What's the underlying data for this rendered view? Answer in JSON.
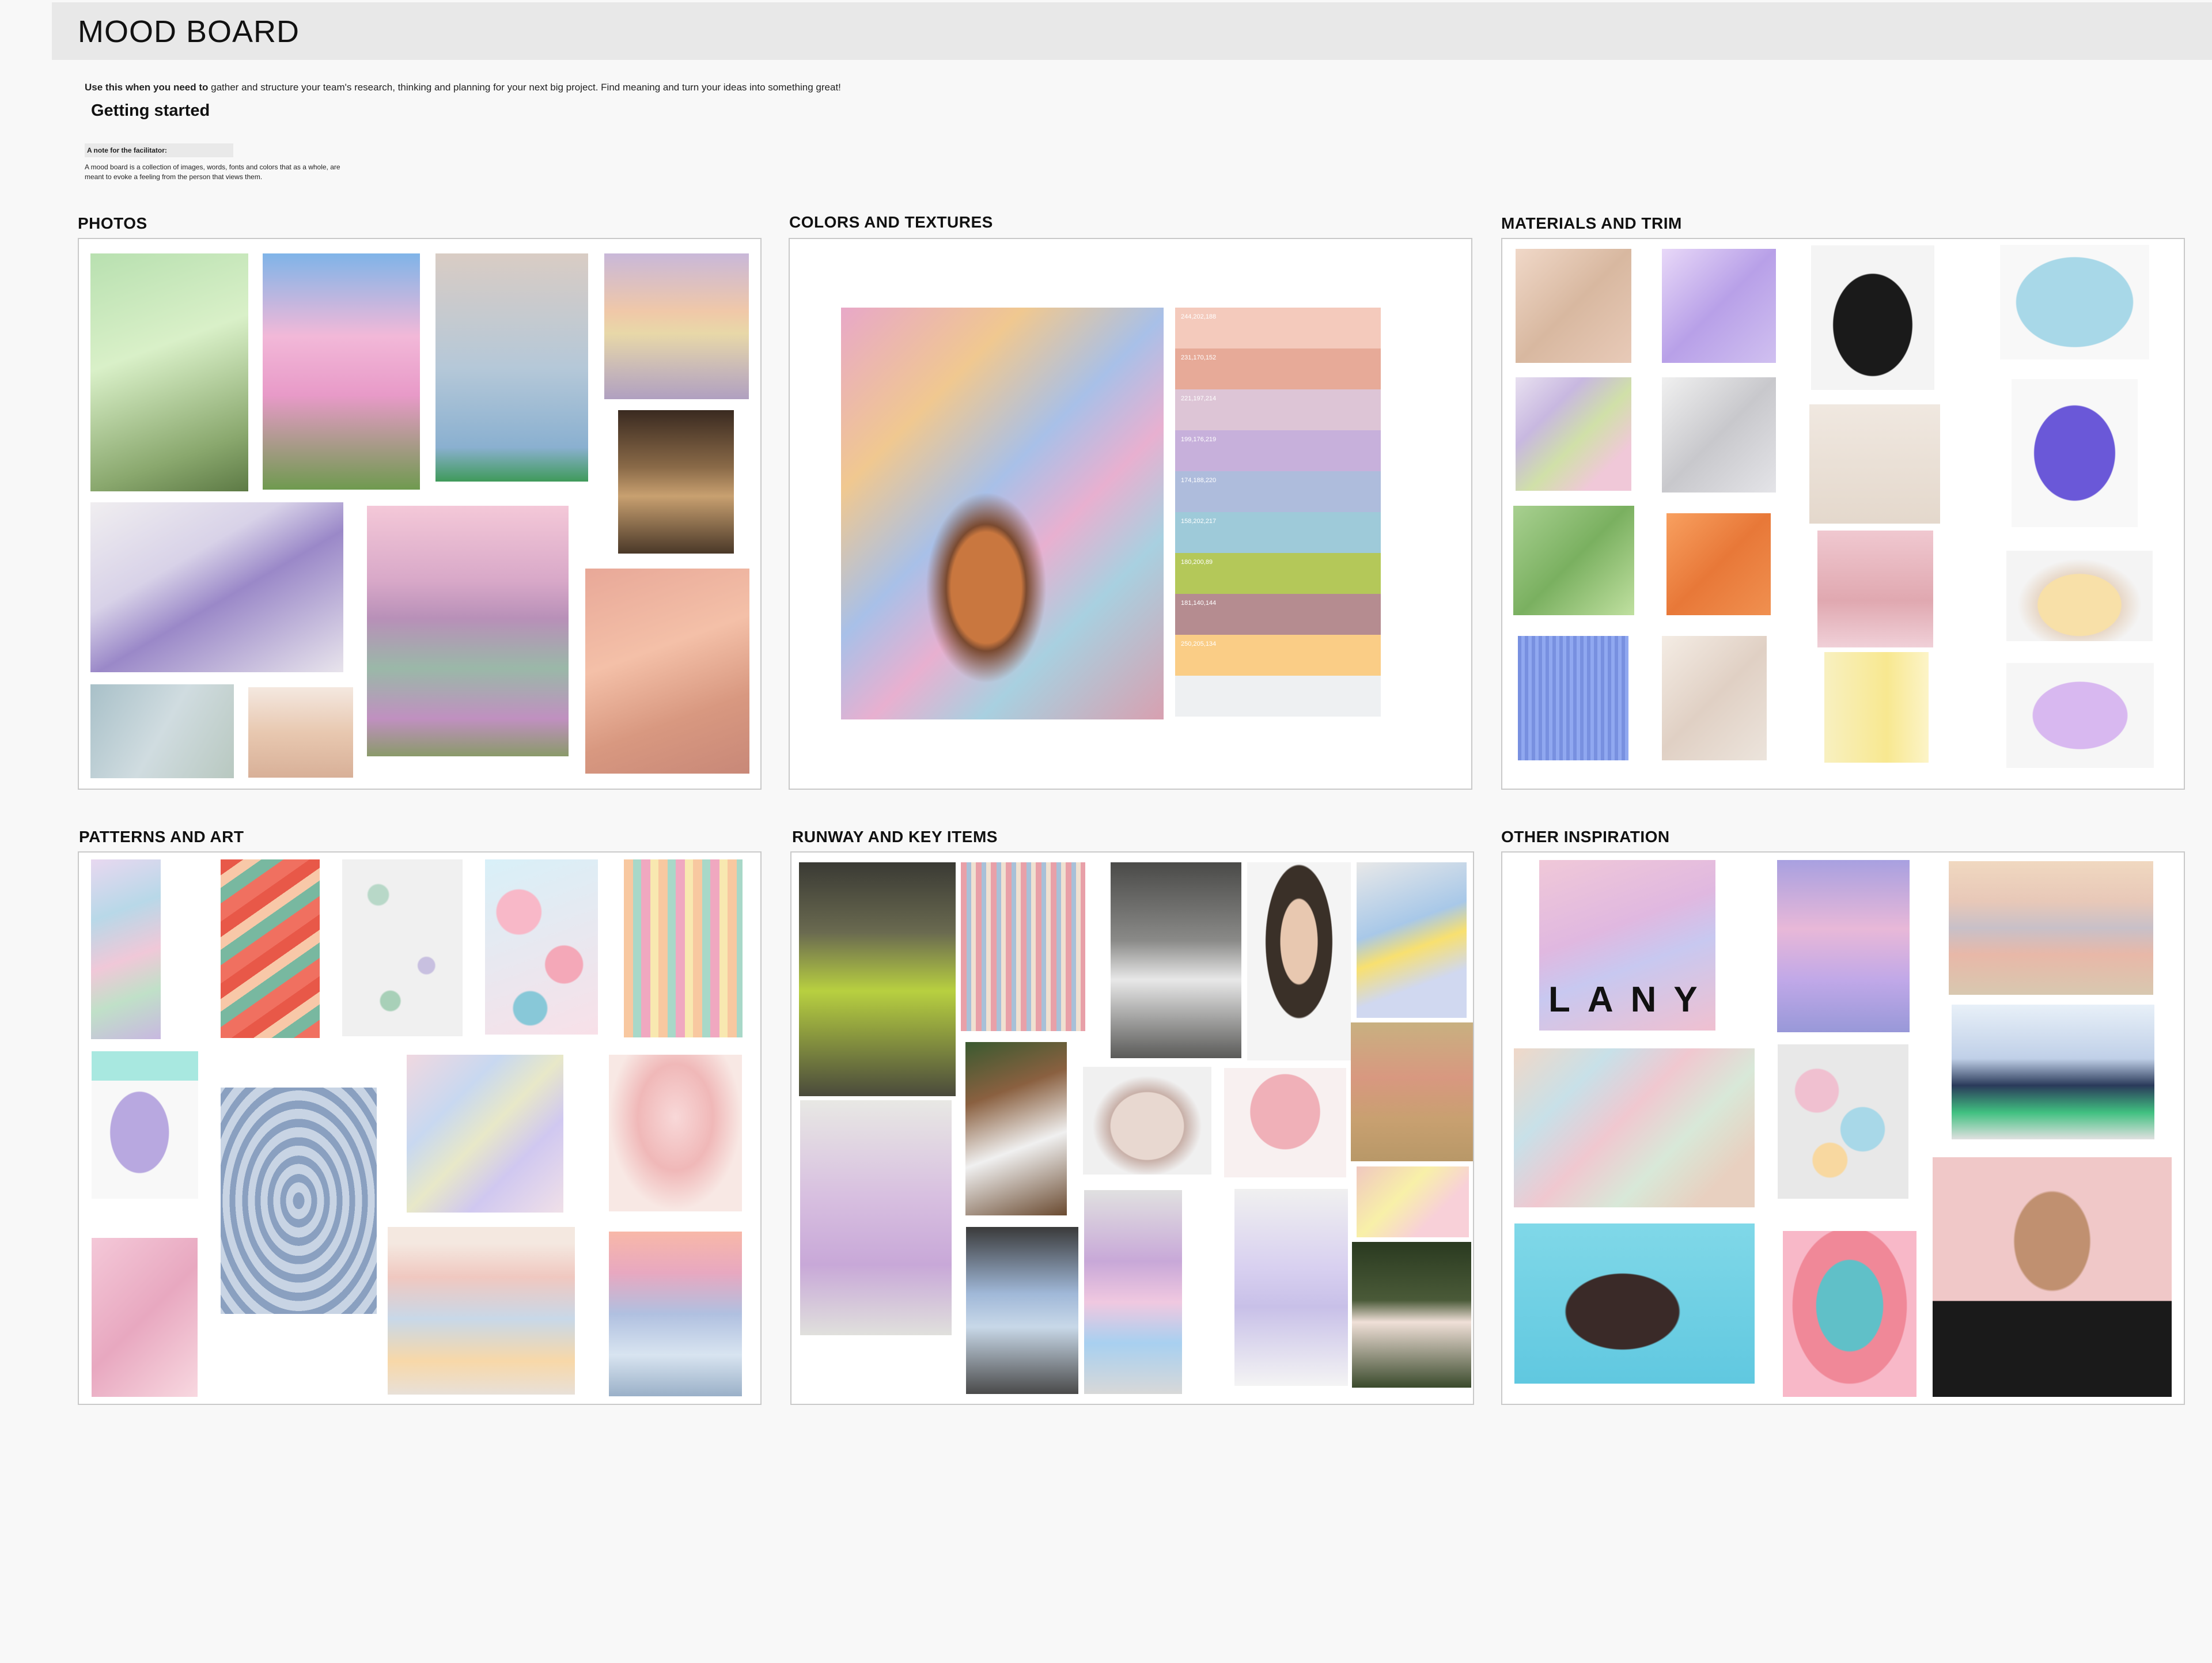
{
  "header": {
    "title": "MOOD BOARD"
  },
  "intro": {
    "bold": "Use this when you need to",
    "rest": " gather and structure your team's research, thinking and planning for your next big project. Find meaning and turn your ideas into something great!"
  },
  "getting_started": "Getting started",
  "note": {
    "label": "A note for the facilitator:",
    "body": "A mood board is a collection of images, words, fonts and colors that as a whole, are meant to evoke a feeling from the person that views them."
  },
  "sections": {
    "photos": "PHOTOS",
    "colors": "COLORS AND TEXTURES",
    "materials": "MATERIALS AND TRIM",
    "patterns": "PATTERNS AND ART",
    "runway": "RUNWAY AND KEY ITEMS",
    "other": "OTHER INSPIRATION"
  },
  "palette": [
    {
      "label": "244,202,188",
      "color": "#f4cabc"
    },
    {
      "label": "231,170,152",
      "color": "#e7aa98"
    },
    {
      "label": "221,197,214",
      "color": "#ddc5d6"
    },
    {
      "label": "199,176,219",
      "color": "#c7b0db"
    },
    {
      "label": "174,188,220",
      "color": "#aebcdc"
    },
    {
      "label": "158,202,217",
      "color": "#9ecad9"
    },
    {
      "label": "180,200,89",
      "color": "#b4c859"
    },
    {
      "label": "181,140,144",
      "color": "#b58c90"
    },
    {
      "label": "250,205,134",
      "color": "#facd86"
    },
    {
      "label": "",
      "color": "#eef0f2"
    }
  ],
  "other_text": {
    "lany": "LANY"
  }
}
